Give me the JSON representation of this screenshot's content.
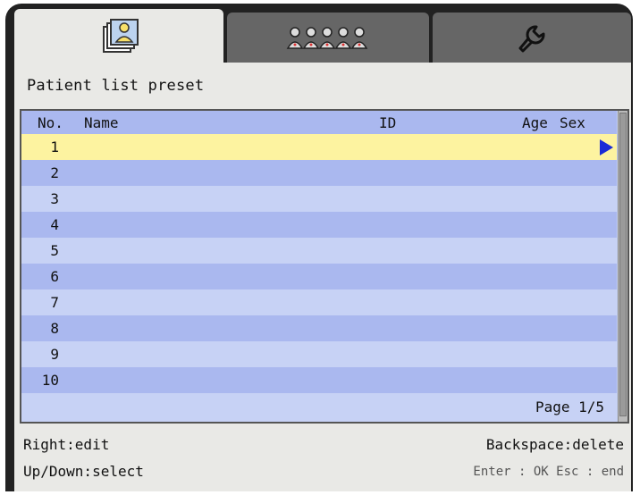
{
  "tabs": [
    {
      "icon": "patient-card-icon",
      "active": true
    },
    {
      "icon": "patients-group-icon",
      "active": false
    },
    {
      "icon": "wrench-icon",
      "active": false
    }
  ],
  "panel": {
    "title": "Patient list preset"
  },
  "table": {
    "columns": {
      "no": "No.",
      "name": "Name",
      "id": "ID",
      "age": "Age",
      "sex": "Sex"
    },
    "rows": [
      "1",
      "2",
      "3",
      "4",
      "5",
      "6",
      "7",
      "8",
      "9",
      "10"
    ],
    "selected_row": "1",
    "page_label": "Page 1/5"
  },
  "hints": {
    "right": "Right:edit",
    "updown": "Up/Down:select",
    "backspace": "Backspace:delete",
    "enter_esc": "Enter : OK  Esc : end"
  },
  "colors": {
    "header": "#aab8ef",
    "row_light": "#c7d2f5",
    "row_dark": "#aab8ef",
    "row_selected": "#fdf3a0",
    "arrow": "#1a2bd6"
  }
}
